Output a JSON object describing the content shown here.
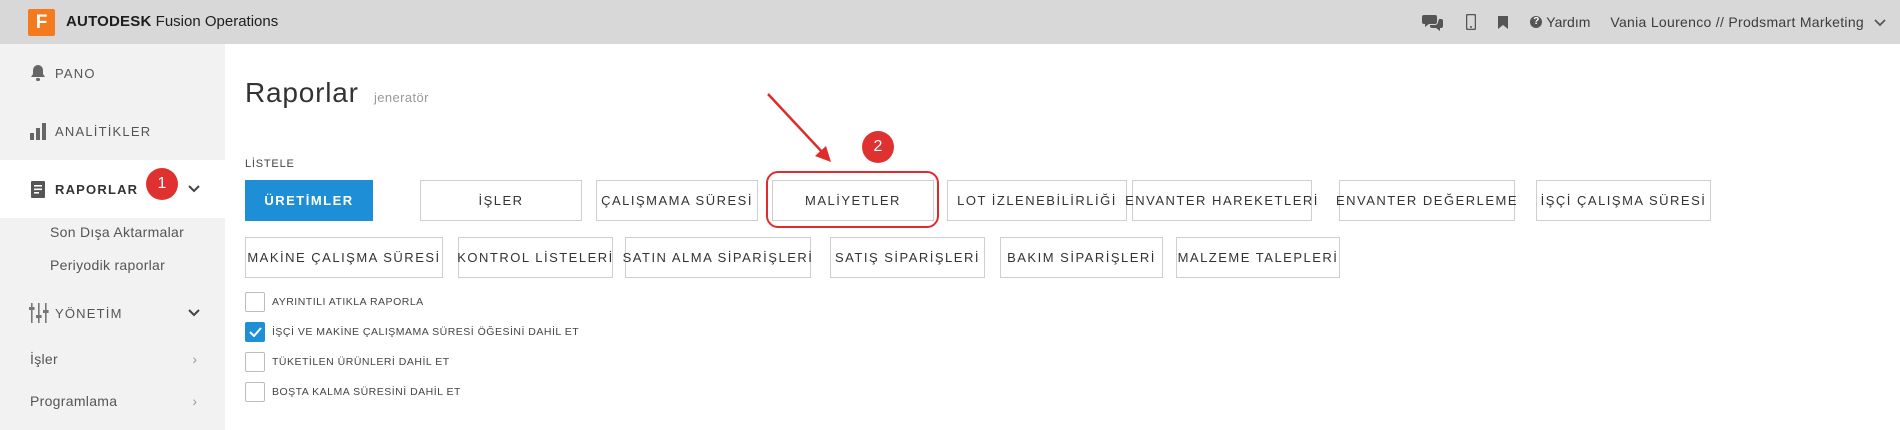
{
  "app": {
    "logo_letter": "F",
    "brand_bold": "AUTODESK",
    "brand_rest": " Fusion Operations",
    "brand_color": "#f37b1d"
  },
  "topbar": {
    "icons": [
      "chat-icon",
      "mobile-icon",
      "bookmark-icon"
    ],
    "help_label": "Yardım",
    "user": "Vania Lourenco // Prodsmart Marketing"
  },
  "sidebar": {
    "items": [
      {
        "label": "PANO",
        "icon": "bell-icon"
      },
      {
        "label": "ANALİTİKLER",
        "icon": "bar-chart-icon"
      },
      {
        "label": "RAPORLAR",
        "icon": "report-icon",
        "active": true
      },
      {
        "label": "YÖNETİM",
        "icon": "sliders-icon"
      }
    ],
    "sub_items": [
      "Son Dışa Aktarmalar",
      "Periyodik raporlar"
    ],
    "simple_items": [
      "İşler",
      "Programlama"
    ]
  },
  "annotations": {
    "badge_1": "1",
    "badge_2": "2",
    "accent": "#e02b2b"
  },
  "main": {
    "title": "Raporlar",
    "subtitle": "jeneratör",
    "section_label": "LİSTELE",
    "buttons_row1": [
      "ÜRETİMLER",
      "İŞLER",
      "ÇALIŞMAMA SÜRESİ",
      "MALİYETLER",
      "LOT İZLENEBİLİRLİĞİ",
      "ENVANTER HAREKETLERİ",
      "ENVANTER DEĞERLEME",
      "İŞÇİ ÇALIŞMA SÜRESİ"
    ],
    "buttons_row2": [
      "MAKİNE ÇALIŞMA SÜRESİ",
      "KONTROL LİSTELERİ",
      "SATIN ALMA SİPARİŞLERİ",
      "SATIŞ SİPARİŞLERİ",
      "BAKIM SİPARİŞLERİ",
      "MALZEME TALEPLERİ"
    ],
    "checkboxes": [
      {
        "label": "AYRINTILI ATIKLA RAPORLA",
        "checked": false
      },
      {
        "label": "İŞÇİ VE MAKİNE ÇALIŞMAMA SÜRESİ ÖĞESİNİ DAHİL ET",
        "checked": true
      },
      {
        "label": "TÜKETİLEN ÜRÜNLERİ DAHİL ET",
        "checked": false
      },
      {
        "label": "BOŞTA KALMA SÜRESİNİ DAHİL ET",
        "checked": false
      }
    ],
    "primary_color": "#1e8fd6"
  }
}
